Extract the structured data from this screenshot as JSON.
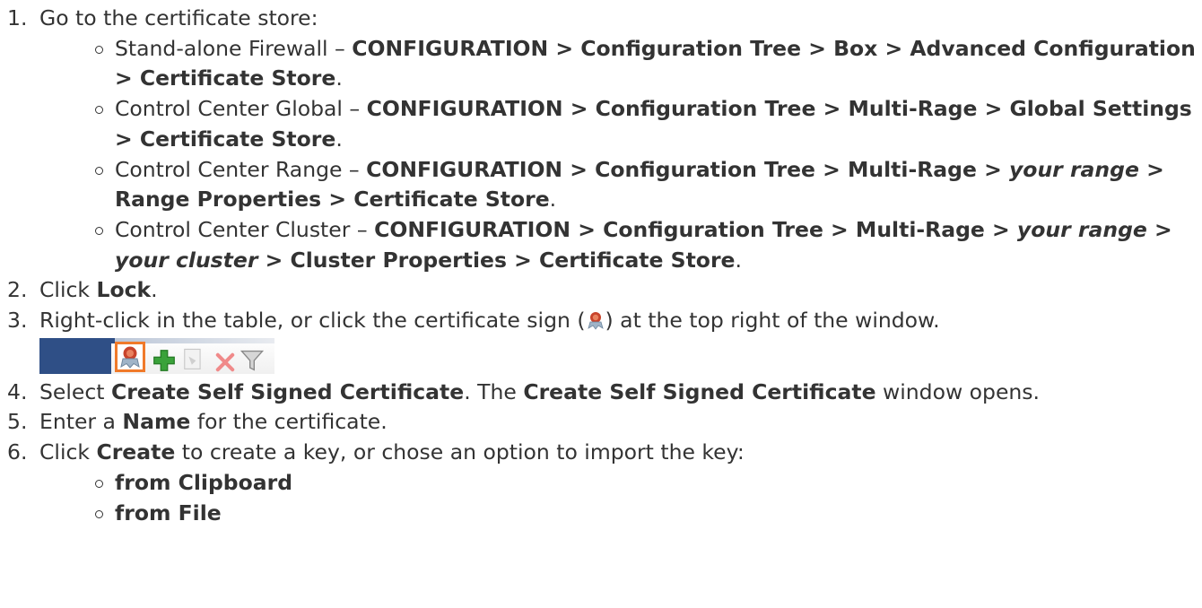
{
  "steps": [
    {
      "num": "1.",
      "text": "Go to the certificate store:",
      "subs": [
        {
          "pre": "Stand-alone Firewall – ",
          "path": "CONFIGURATION > Configuration Tree > Box > Advanced Configuration > Certificate Store",
          "post": "."
        },
        {
          "pre": "Control Center Global – ",
          "path": "CONFIGURATION > Configuration Tree > Multi-Rage > Global Settings > Certificate Store",
          "post": "."
        },
        {
          "pre": "Control Center Range – ",
          "path_a": "CONFIGURATION > Configuration Tree > Multi-Rage > ",
          "em_a": "your range",
          "path_b": " > Range Properties > Certificate Store",
          "post": "."
        },
        {
          "pre": "Control Center Cluster – ",
          "path_a": "CONFIGURATION > Configuration Tree > Multi-Rage > ",
          "em_a": "your range",
          "mid": " > ",
          "em_b": "your cluster",
          "path_b": " > Cluster Properties > Certificate Store",
          "post": "."
        }
      ]
    },
    {
      "num": "2.",
      "pre": "Click ",
      "bold": "Lock",
      "post": "."
    },
    {
      "num": "3.",
      "pre": "Right-click in the table, or click the certificate sign (",
      "post": ") at the top right of the window."
    },
    {
      "num": "4.",
      "pre": "Select ",
      "bold": "Create Self Signed Certificate",
      "mid": ". The ",
      "bold2": "Create Self Signed Certificate",
      "post": " window opens."
    },
    {
      "num": "5.",
      "pre": "Enter a ",
      "bold": "Name",
      "post": " for the certificate."
    },
    {
      "num": "6.",
      "pre": "Click ",
      "bold": "Create",
      "post": " to create a key, or chose an option to import the key:",
      "subs": [
        {
          "bold": "from Clipboard"
        },
        {
          "bold": "from File"
        }
      ]
    }
  ],
  "toolbar": {
    "icons": [
      "certificate-icon",
      "add-icon",
      "edit-icon",
      "delete-icon",
      "filter-icon"
    ],
    "accent": "#f07a2a",
    "band_color": "#2f4f86"
  }
}
